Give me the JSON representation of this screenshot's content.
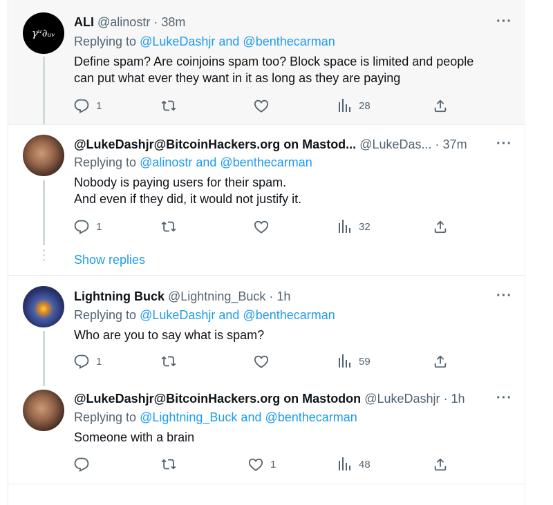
{
  "tweets": [
    {
      "name": "ALI",
      "handle": "@alinostr",
      "time": "· 38m",
      "replying_prefix": "Replying to ",
      "replying_to": "@LukeDashjr and @benthecarman",
      "text_lines": [
        "Define spam? Are coinjoins spam too? Block space is limited and people",
        "can put what ever they want in it as long as they are paying"
      ],
      "reply_count": "1",
      "retweet_count": "",
      "like_count": "",
      "views": "28",
      "avatar_text": "γᵘ∂ᵤᵥ"
    },
    {
      "name": "@LukeDashjr@BitcoinHackers.org on Mastod...",
      "handle": "@LukeDas...",
      "time": "· 37m",
      "replying_prefix": "Replying to ",
      "replying_to": "@alinostr and @benthecarman",
      "text_lines": [
        "Nobody is paying users for their spam.",
        "And even if they did, it would not justify it."
      ],
      "reply_count": "1",
      "retweet_count": "",
      "like_count": "",
      "views": "32"
    },
    {
      "name": "Lightning Buck",
      "handle": "@Lightning_Buck",
      "time": "· 1h",
      "replying_prefix": "Replying to ",
      "replying_to": "@LukeDashjr and @benthecarman",
      "text_lines": [
        "Who are you to say what is spam?"
      ],
      "reply_count": "1",
      "retweet_count": "",
      "like_count": "",
      "views": "59"
    },
    {
      "name": "@LukeDashjr@BitcoinHackers.org on Mastodon",
      "handle": "@LukeDashjr",
      "time": "· 1h",
      "replying_prefix": "Replying to ",
      "replying_to": "@Lightning_Buck and @benthecarman",
      "text_lines": [
        "Someone with a brain"
      ],
      "reply_count": "",
      "retweet_count": "",
      "like_count": "1",
      "views": "48"
    }
  ],
  "show_replies": "Show replies",
  "more_label": "···",
  "colors": {
    "accent": "#1d9bf0",
    "muted": "#536471",
    "text": "#0f1419",
    "line": "#cfd9de"
  },
  "icons": [
    "reply-icon",
    "retweet-icon",
    "like-icon",
    "views-icon",
    "share-icon",
    "more-icon"
  ]
}
